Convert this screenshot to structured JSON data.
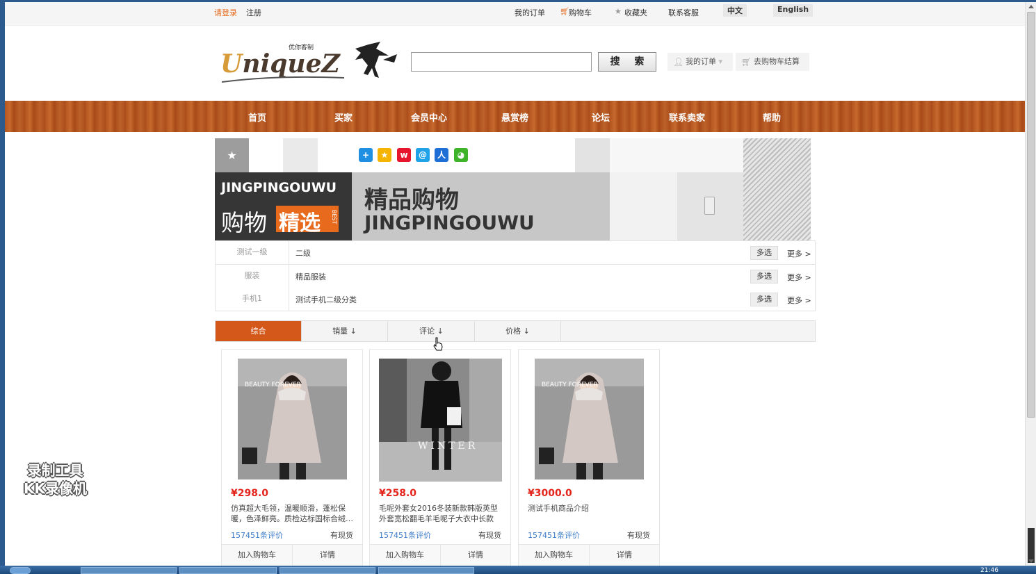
{
  "topbar": {
    "login": "请登录",
    "register": "注册",
    "my_orders": "我的订单",
    "cart": "购物车",
    "favorites": "收藏夹",
    "customer_service": "联系客服",
    "lang_cn": "中文",
    "lang_en": "English"
  },
  "header": {
    "logo_text": "UniqueZ",
    "logo_sub": "优你客制",
    "search_placeholder": "",
    "search_button": "搜 索",
    "my_orders": "我的订单",
    "checkout": "去购物车结算"
  },
  "nav": [
    "首页",
    "买家",
    "会员中心",
    "悬赏榜",
    "论坛",
    "联系卖家",
    "帮助"
  ],
  "banner": {
    "en_title": "JINGPINGOUWU",
    "cn_left": "购物",
    "cn_highlight": "精选",
    "best": "BEST",
    "cn_title": "精品购物",
    "en_title2": "JINGPINGOUWU"
  },
  "categories": [
    {
      "label": "测试一级",
      "value": "二级",
      "multi": "多选",
      "more": "更多 >"
    },
    {
      "label": "服装",
      "value": "精品服装",
      "multi": "多选",
      "more": "更多 >"
    },
    {
      "label": "手机1",
      "value": "测试手机二级分类",
      "multi": "多选",
      "more": "更多 >"
    }
  ],
  "sort_tabs": [
    "综合",
    "销量 ↓",
    "评论 ↓",
    "价格 ↓"
  ],
  "products": [
    {
      "price": "¥298.0",
      "desc": "仿真超大毛领，温暖顺滑，蓬松保暖，色泽鲜亮。质检达标国标合绒…",
      "reviews": "157451条评价",
      "stock": "有现货",
      "add_cart": "加入购物车",
      "detail": "详情",
      "img_text": "BEAUTY FOREVER"
    },
    {
      "price": "¥258.0",
      "desc": "毛呢外套女2016冬装新款韩版英型外套宽松翻毛羊毛呢子大衣中长款",
      "reviews": "157451条评价",
      "stock": "有现货",
      "add_cart": "加入购物车",
      "detail": "详情",
      "img_text": "WINTER"
    },
    {
      "price": "¥3000.0",
      "desc": "测试手机商品介绍",
      "reviews": "157451条评价",
      "stock": "有现货",
      "add_cart": "加入购物车",
      "detail": "详情",
      "img_text": "BEAUTY FOREVER"
    }
  ],
  "watermark": {
    "line1": "录制工具",
    "line2": "KK录像机"
  },
  "taskbar": {
    "clock": "21:46"
  },
  "colors": {
    "accent": "#e86a1c",
    "nav_wood": "#b2541e",
    "price": "#e3251b",
    "link": "#3a7bc8"
  }
}
